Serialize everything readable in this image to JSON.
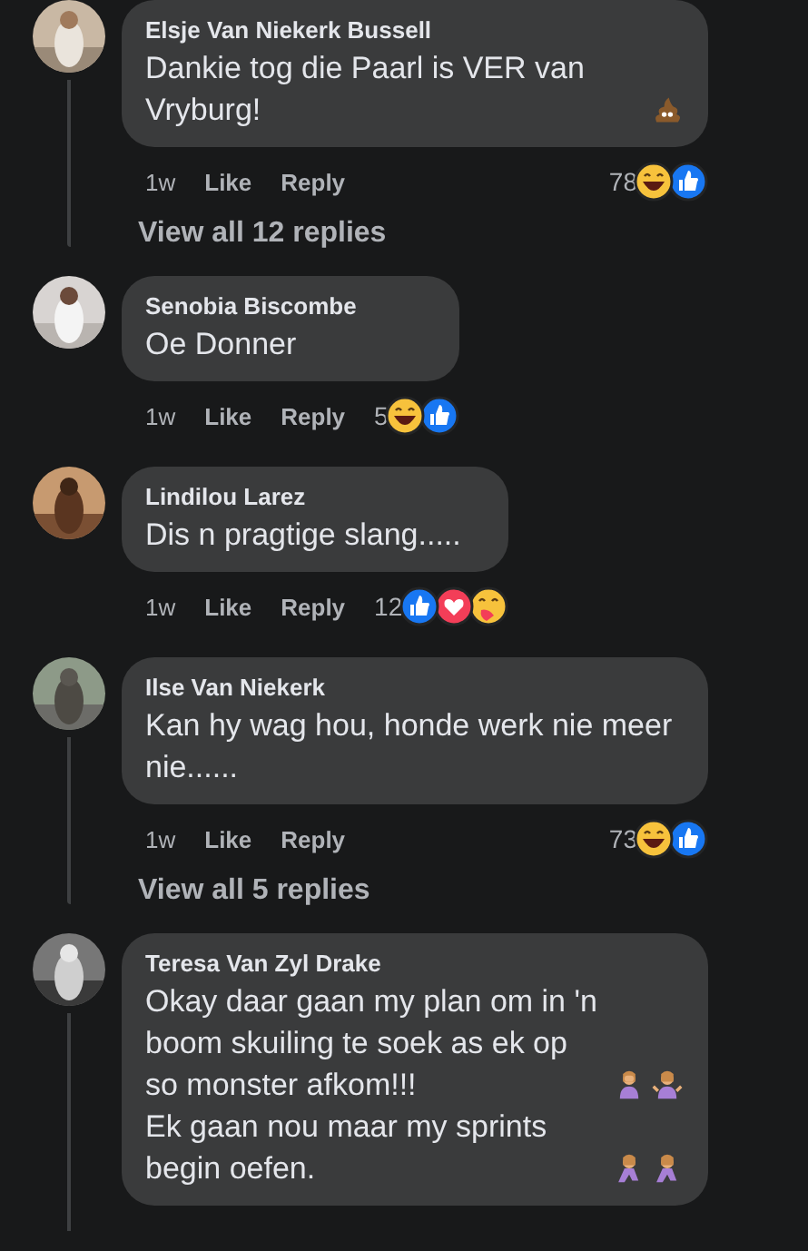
{
  "comments": [
    {
      "author": "Elsje Van Niekerk Bussell",
      "avatar": {
        "kind": "picture"
      },
      "lines": [
        {
          "text": "Dankie tog die Paarl is VER van Vryburg!",
          "icons": [
            {
              "kind": "poop"
            }
          ]
        }
      ],
      "time": "1w",
      "like": "Like",
      "reply": "Reply",
      "reaction_count": "78",
      "reactions": [
        {
          "kind": "haha"
        },
        {
          "kind": "like"
        }
      ],
      "thread_line": true,
      "replies_link": "View all 12 replies"
    },
    {
      "author": "Senobia Biscombe",
      "avatar": {
        "kind": "picture"
      },
      "lines": [
        {
          "text": "Oe Donner"
        }
      ],
      "time": "1w",
      "like": "Like",
      "reply": "Reply",
      "reaction_count": "5",
      "reactions": [
        {
          "kind": "haha"
        },
        {
          "kind": "like"
        }
      ],
      "thread_line": false
    },
    {
      "author": "Lindilou Larez",
      "avatar": {
        "kind": "picture"
      },
      "lines": [
        {
          "text": "Dis n pragtige slang....."
        }
      ],
      "time": "1w",
      "like": "Like",
      "reply": "Reply",
      "reaction_count": "12",
      "reactions": [
        {
          "kind": "like"
        },
        {
          "kind": "love"
        },
        {
          "kind": "care"
        }
      ],
      "thread_line": false
    },
    {
      "author": "Ilse Van Niekerk",
      "avatar": {
        "kind": "picture"
      },
      "lines": [
        {
          "text": "Kan hy wag hou, honde werk nie meer nie......"
        }
      ],
      "time": "1w",
      "like": "Like",
      "reply": "Reply",
      "reaction_count": "73",
      "reactions": [
        {
          "kind": "haha"
        },
        {
          "kind": "like"
        }
      ],
      "thread_line": true,
      "replies_link": "View all 5 replies"
    },
    {
      "author": "Teresa Van Zyl Drake",
      "avatar": {
        "kind": "picture"
      },
      "lines": [
        {
          "text": "Okay daar gaan my plan om in 'n boom skuiling te soek as ek op so monster afkom!!!",
          "icons": [
            {
              "kind": "facepalm"
            },
            {
              "kind": "shrug"
            }
          ]
        },
        {
          "text": "Ek gaan nou maar my sprints begin oefen.",
          "icons": [
            {
              "kind": "runner"
            },
            {
              "kind": "runner"
            }
          ]
        }
      ],
      "thread_line": true
    }
  ]
}
